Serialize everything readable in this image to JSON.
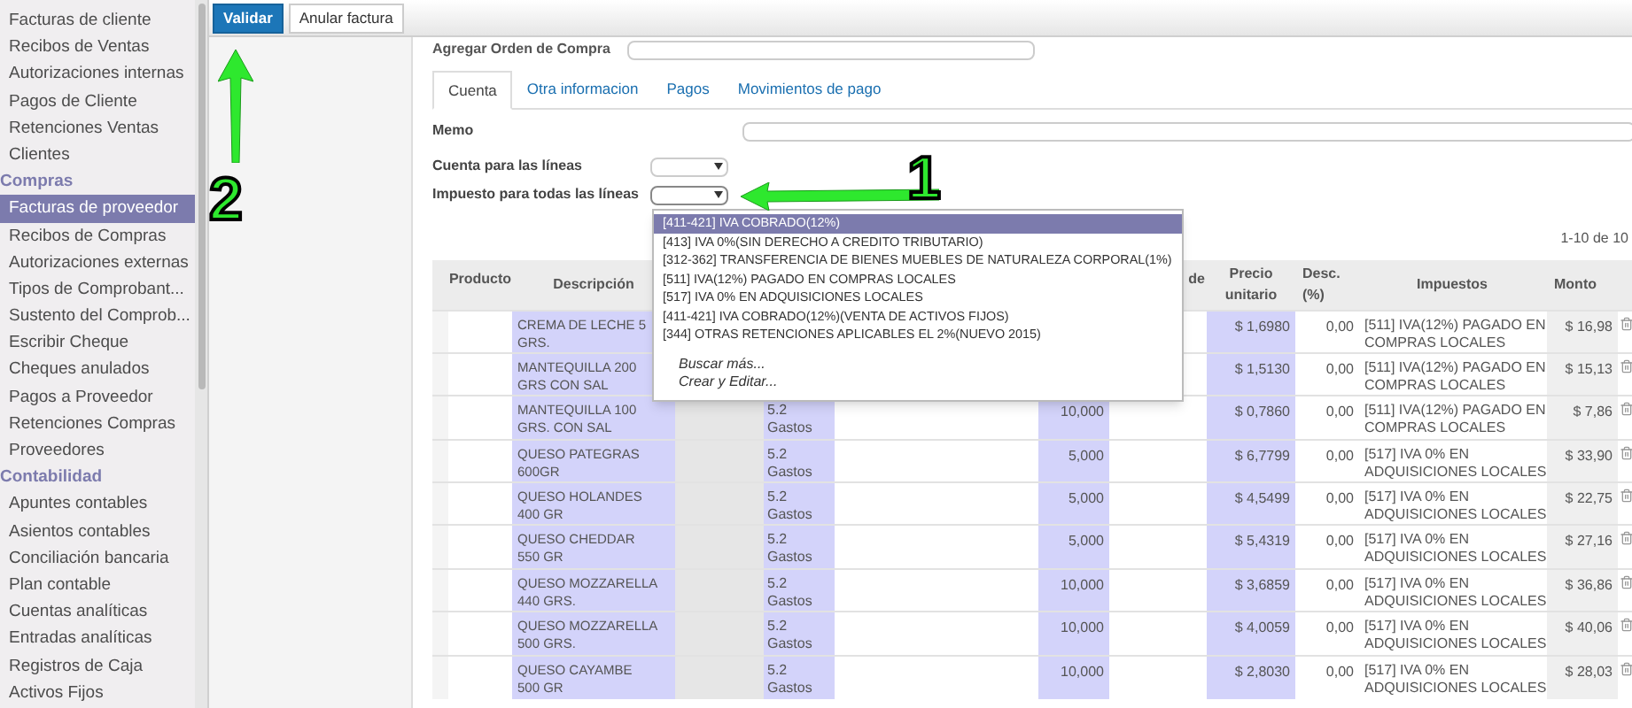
{
  "sidebar": {
    "items": [
      {
        "kind": "item",
        "label": "Facturas de cliente",
        "selected": false
      },
      {
        "kind": "item",
        "label": "Recibos de Ventas",
        "selected": false
      },
      {
        "kind": "item",
        "label": "Autorizaciones internas",
        "selected": false
      },
      {
        "kind": "item",
        "label": "Pagos de Cliente",
        "selected": false
      },
      {
        "kind": "item",
        "label": "Retenciones Ventas",
        "selected": false
      },
      {
        "kind": "item",
        "label": "Clientes",
        "selected": false
      },
      {
        "kind": "section",
        "label": "Compras"
      },
      {
        "kind": "item",
        "label": "Facturas de proveedor",
        "selected": true
      },
      {
        "kind": "item",
        "label": "Recibos de Compras",
        "selected": false
      },
      {
        "kind": "item",
        "label": "Autorizaciones externas",
        "selected": false
      },
      {
        "kind": "item",
        "label": "Tipos de Comprobant...",
        "selected": false
      },
      {
        "kind": "item",
        "label": "Sustento del Comprob...",
        "selected": false
      },
      {
        "kind": "item",
        "label": "Escribir Cheque",
        "selected": false
      },
      {
        "kind": "item",
        "label": "Cheques anulados",
        "selected": false
      },
      {
        "kind": "item",
        "label": "Pagos a Proveedor",
        "selected": false
      },
      {
        "kind": "item",
        "label": "Retenciones Compras",
        "selected": false
      },
      {
        "kind": "item",
        "label": "Proveedores",
        "selected": false
      },
      {
        "kind": "section",
        "label": "Contabilidad"
      },
      {
        "kind": "item",
        "label": "Apuntes contables",
        "selected": false
      },
      {
        "kind": "item",
        "label": "Asientos contables",
        "selected": false
      },
      {
        "kind": "item",
        "label": "Conciliación bancaria",
        "selected": false
      },
      {
        "kind": "item",
        "label": "Plan contable",
        "selected": false
      },
      {
        "kind": "item",
        "label": "Cuentas analíticas",
        "selected": false
      },
      {
        "kind": "item",
        "label": "Entradas analíticas",
        "selected": false
      },
      {
        "kind": "item",
        "label": "Registros de Caja",
        "selected": false
      },
      {
        "kind": "item",
        "label": "Activos Fijos",
        "selected": false
      }
    ]
  },
  "toolbar": {
    "buttons": [
      {
        "label": "Validar",
        "kind": "primary"
      },
      {
        "label": "Anular factura",
        "kind": "default"
      }
    ]
  },
  "form": {
    "purchase_order_label": "Agregar Orden de Compra",
    "tabs": [
      {
        "label": "Cuenta",
        "selected": true
      },
      {
        "label": "Otra informacion",
        "selected": false
      },
      {
        "label": "Pagos",
        "selected": false
      },
      {
        "label": "Movimientos de pago",
        "selected": false
      }
    ],
    "memo_label": "Memo",
    "account_label": "Cuenta para las líneas",
    "tax_label": "Impuesto para todas las líneas"
  },
  "tax_dropdown": {
    "options": [
      {
        "label": "[411-421] IVA COBRADO(12%)",
        "selected": true
      },
      {
        "label": "[413] IVA 0%(SIN DERECHO A CREDITO TRIBUTARIO)",
        "selected": false
      },
      {
        "label": "[312-362] TRANSFERENCIA DE BIENES MUEBLES DE NATURALEZA CORPORAL(1%)",
        "selected": false
      },
      {
        "label": "[511] IVA(12%) PAGADO EN COMPRAS LOCALES",
        "selected": false
      },
      {
        "label": "[517] IVA 0% EN ADQUISICIONES LOCALES",
        "selected": false
      },
      {
        "label": "[411-421] IVA COBRADO(12%)(VENTA DE ACTIVOS FIJOS)",
        "selected": false
      },
      {
        "label": "[344] OTRAS RETENCIONES APLICABLES EL 2%(NUEVO 2015)",
        "selected": false
      }
    ],
    "actions": [
      "Buscar más...",
      "Crear y Editar..."
    ]
  },
  "table": {
    "pager": "1-10 de 10",
    "columns": {
      "product": "Producto",
      "description": "Descripción",
      "column_7": "de",
      "unit_price": "Precio unitario",
      "discount": "Desc. (%)",
      "taxes": "Impuestos",
      "amount": "Monto"
    },
    "rows": [
      {
        "description": "CREMA DE LECHE 5 GRS.",
        "price": "$ 1,6980",
        "discount": "0,00",
        "taxes": "[511] IVA(12%) PAGADO EN COMPRAS LOCALES",
        "amount": "$ 16,98"
      },
      {
        "description": "MANTEQUILLA 200 GRS CON SAL",
        "price": "$ 1,5130",
        "discount": "0,00",
        "taxes": "[511] IVA(12%) PAGADO EN COMPRAS LOCALES",
        "amount": "$ 15,13"
      },
      {
        "description": "MANTEQUILLA 100 GRS. CON SAL",
        "account": "5.2 Gastos",
        "quantity": "10,000",
        "price": "$ 0,7860",
        "discount": "0,00",
        "taxes": "[511] IVA(12%) PAGADO EN COMPRAS LOCALES",
        "amount": "$ 7,86"
      },
      {
        "description": "QUESO PATEGRAS 600GR",
        "account": "5.2 Gastos",
        "quantity": "5,000",
        "price": "$ 6,7799",
        "discount": "0,00",
        "taxes": "[517] IVA 0% EN ADQUISICIONES LOCALES",
        "amount": "$ 33,90"
      },
      {
        "description": "QUESO HOLANDES 400 GR",
        "account": "5.2 Gastos",
        "quantity": "5,000",
        "price": "$ 4,5499",
        "discount": "0,00",
        "taxes": "[517] IVA 0% EN ADQUISICIONES LOCALES",
        "amount": "$ 22,75"
      },
      {
        "description": "QUESO CHEDDAR 550 GR",
        "account": "5.2 Gastos",
        "quantity": "5,000",
        "price": "$ 5,4319",
        "discount": "0,00",
        "taxes": "[517] IVA 0% EN ADQUISICIONES LOCALES",
        "amount": "$ 27,16"
      },
      {
        "description": "QUESO MOZZARELLA 440 GRS.",
        "account": "5.2 Gastos",
        "quantity": "10,000",
        "price": "$ 3,6859",
        "discount": "0,00",
        "taxes": "[517] IVA 0% EN ADQUISICIONES LOCALES",
        "amount": "$ 36,86"
      },
      {
        "description": "QUESO MOZZARELLA 500 GRS.",
        "account": "5.2 Gastos",
        "quantity": "10,000",
        "price": "$ 4,0059",
        "discount": "0,00",
        "taxes": "[517] IVA 0% EN ADQUISICIONES LOCALES",
        "amount": "$ 40,06"
      },
      {
        "description": "QUESO CAYAMBE 500 GR",
        "account": "5.2 Gastos",
        "quantity": "10,000",
        "price": "$ 2,8030",
        "discount": "0,00",
        "taxes": "[517] IVA 0% EN ADQUISICIONES LOCALES",
        "amount": "$ 28,03"
      }
    ]
  },
  "annotations": [
    {
      "label": "1"
    },
    {
      "label": "2"
    }
  ]
}
